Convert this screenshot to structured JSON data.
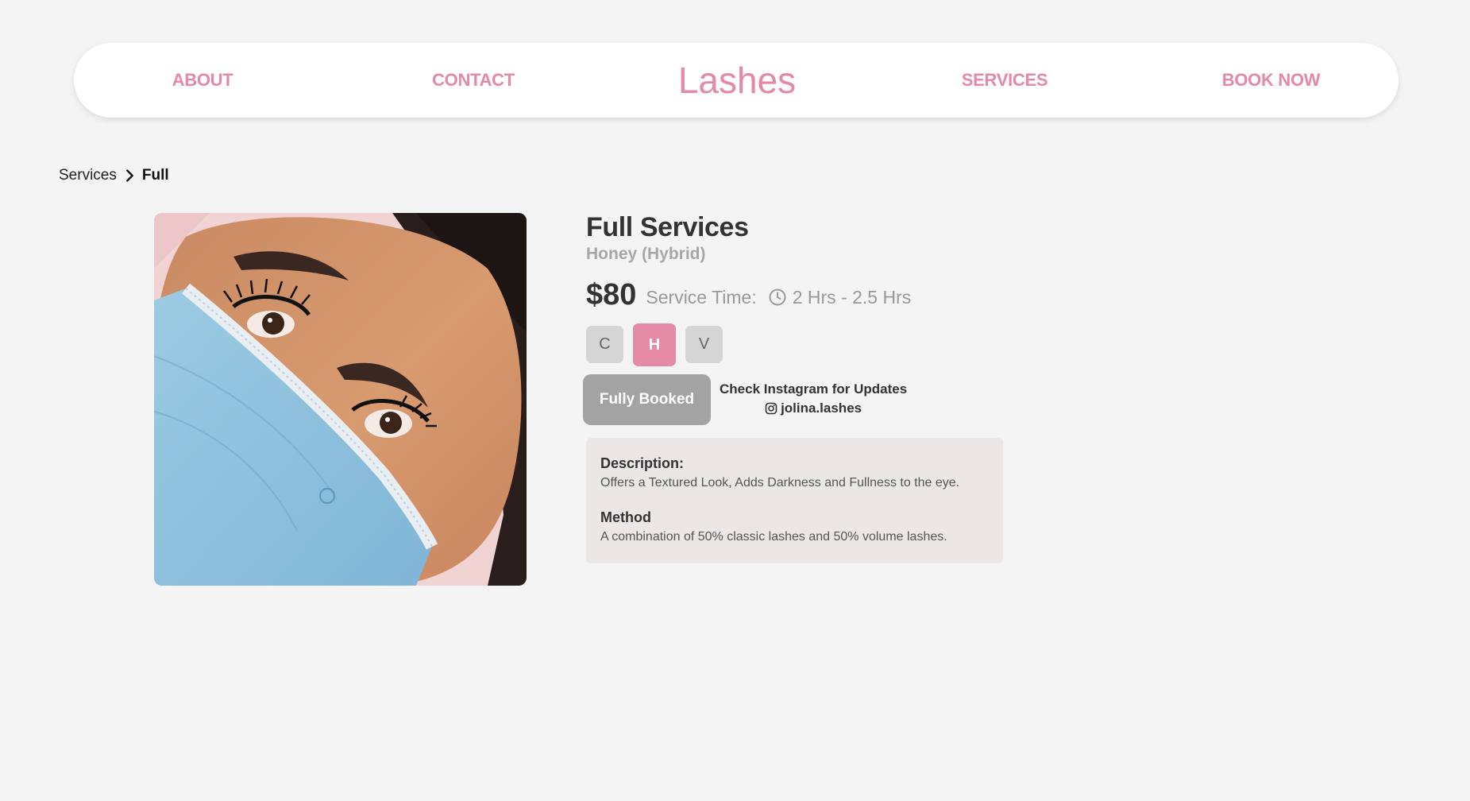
{
  "nav": {
    "about": "ABOUT",
    "contact": "CONTACT",
    "logo": "Lashes",
    "services": "SERVICES",
    "book_now": "BOOK NOW"
  },
  "breadcrumb": {
    "parent": "Services",
    "current": "Full"
  },
  "product": {
    "image_alt": "Client with lash extensions wearing a blue face mask",
    "title": "Full Services",
    "subtitle": "Honey (Hybrid)",
    "price": "$80",
    "service_time_label": "Service Time:",
    "service_time_value": "2 Hrs - 2.5 Hrs",
    "types": [
      {
        "label": "C",
        "selected": false
      },
      {
        "label": "H",
        "selected": true
      },
      {
        "label": "V",
        "selected": false
      }
    ],
    "booking_status": "Fully Booked",
    "instagram_note": "Check Instagram for Updates",
    "instagram_handle": "jolina.lashes",
    "description_heading": "Description:",
    "description_text": "Offers a Textured Look, Adds Darkness and Fullness to the eye.",
    "method_heading": "Method",
    "method_text": "A combination of 50% classic lashes and 50% volume lashes."
  },
  "colors": {
    "accent": "#e48aa6",
    "page_bg": "#f4f4f4",
    "box_bg": "#ebe7e7",
    "disabled_button": "#a3a3a3"
  },
  "icons": {
    "breadcrumb_separator": "chevron-right-icon",
    "service_time": "clock-icon",
    "instagram": "instagram-icon"
  }
}
